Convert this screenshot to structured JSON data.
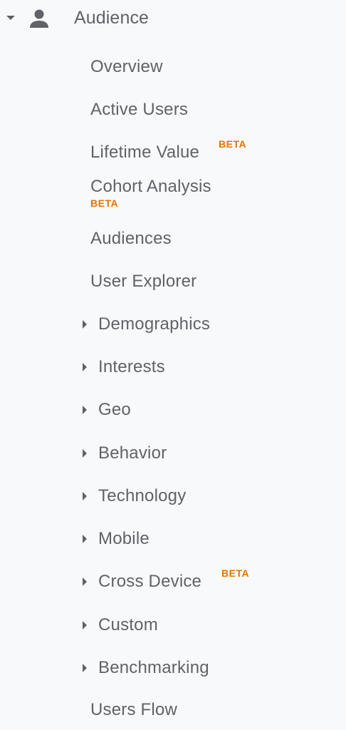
{
  "section": {
    "title": "Audience",
    "icon": "person-icon",
    "expand_icon": "caret-down-icon"
  },
  "items": [
    {
      "label": "Overview"
    },
    {
      "label": "Active Users"
    },
    {
      "label": "Lifetime Value",
      "badge": "BETA"
    },
    {
      "label": "Cohort Analysis",
      "badge": "BETA"
    },
    {
      "label": "Audiences"
    },
    {
      "label": "User Explorer"
    },
    {
      "label": "Demographics",
      "expandable": true
    },
    {
      "label": "Interests",
      "expandable": true
    },
    {
      "label": "Geo",
      "expandable": true
    },
    {
      "label": "Behavior",
      "expandable": true
    },
    {
      "label": "Technology",
      "expandable": true
    },
    {
      "label": "Mobile",
      "expandable": true
    },
    {
      "label": "Cross Device",
      "expandable": true,
      "badge": "BETA"
    },
    {
      "label": "Custom",
      "expandable": true
    },
    {
      "label": "Benchmarking",
      "expandable": true
    },
    {
      "label": "Users Flow"
    }
  ],
  "colors": {
    "background": "#f8f9fa",
    "text": "#5f6368",
    "beta": "#e37400"
  }
}
